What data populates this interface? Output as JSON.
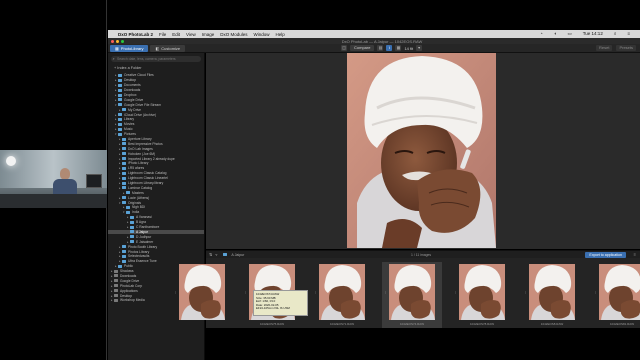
{
  "menubar": {
    "apple": "",
    "app_name": "DxO PhotoLab 2",
    "items": [
      "File",
      "Edit",
      "View",
      "Image",
      "DxO Modules",
      "Window",
      "Help"
    ],
    "clock": "Tue 14:12"
  },
  "window": {
    "title": "DxO PhotoLab — A Jaipur — 1042EOS.RAW"
  },
  "toolbar": {
    "tabs": [
      {
        "label": "PhotoLibrary"
      },
      {
        "label": "Customize"
      }
    ],
    "compare": "Compare",
    "zoom": "14 fit",
    "reset": "Reset",
    "presets": "Presets"
  },
  "sidebar": {
    "search_placeholder": "Search date, lens, camera, parameters",
    "add_folder": "Index a Folder",
    "tree": [
      {
        "label": "Creative Cloud Files",
        "depth": 1,
        "tri": "▸"
      },
      {
        "label": "Desktop",
        "depth": 1,
        "tri": "▸"
      },
      {
        "label": "Documents",
        "depth": 1,
        "tri": "▸"
      },
      {
        "label": "Downloads",
        "depth": 1,
        "tri": "▸"
      },
      {
        "label": "Dropbox",
        "depth": 1,
        "tri": "▸"
      },
      {
        "label": "Google Drive",
        "depth": 1,
        "tri": "▸"
      },
      {
        "label": "Google Drive File Stream",
        "depth": 1,
        "tri": "▾"
      },
      {
        "label": "My Drive",
        "depth": 2,
        "tri": "▸"
      },
      {
        "label": "iCloud Drive (Archive)",
        "depth": 1,
        "tri": "▸"
      },
      {
        "label": "Library",
        "depth": 1,
        "tri": "▸"
      },
      {
        "label": "Movies",
        "depth": 1,
        "tri": "▸"
      },
      {
        "label": "Music",
        "depth": 1,
        "tri": "▸"
      },
      {
        "label": "Pictures",
        "depth": 1,
        "tri": "▾"
      },
      {
        "label": "Aperture Library",
        "depth": 2,
        "tri": "▸"
      },
      {
        "label": "Best Impressive Photos",
        "depth": 2,
        "tri": "▸"
      },
      {
        "label": "DxO Lab Images",
        "depth": 2,
        "tri": "▸"
      },
      {
        "label": "Hoboken (Joe 6M)",
        "depth": 2,
        "tri": "▸"
      },
      {
        "label": "Imported Library 2 already dupe",
        "depth": 2,
        "tri": "▸"
      },
      {
        "label": "iPhoto Library",
        "depth": 2,
        "tri": "▸"
      },
      {
        "label": "LR5 afores",
        "depth": 2,
        "tri": "▸"
      },
      {
        "label": "Lightroom Classic Catalog",
        "depth": 2,
        "tri": "▸"
      },
      {
        "label": "Lightroom Classic Lineartel",
        "depth": 2,
        "tri": "▸"
      },
      {
        "label": "Lightroom Library.library",
        "depth": 2,
        "tri": "▸"
      },
      {
        "label": "Luminar Catalog",
        "depth": 2,
        "tri": "▸"
      },
      {
        "label": "Masters",
        "depth": 3,
        "tri": "▸"
      },
      {
        "label": "Lucie (Athens)",
        "depth": 2,
        "tri": "▸"
      },
      {
        "label": "Originals",
        "depth": 2,
        "tri": "▾"
      },
      {
        "label": "Nigh BDI",
        "depth": 3,
        "tri": "▸"
      },
      {
        "label": "India",
        "depth": 3,
        "tri": "▾"
      },
      {
        "label": "A Varanasi",
        "depth": 4,
        "tri": "▸"
      },
      {
        "label": "B Agra",
        "depth": 4,
        "tri": "▸"
      },
      {
        "label": "C Ranthambore",
        "depth": 4,
        "tri": "▸"
      },
      {
        "label": "A Jaipur",
        "depth": 4,
        "tri": "",
        "selected": true
      },
      {
        "label": "D Jodhpur",
        "depth": 4,
        "tri": "▸"
      },
      {
        "label": "E Jaisalmer",
        "depth": 4,
        "tri": "▸"
      },
      {
        "label": "Photo Booth Library",
        "depth": 2,
        "tri": "▸"
      },
      {
        "label": "Photos Library",
        "depth": 2,
        "tri": "▸"
      },
      {
        "label": "Selectedvaults",
        "depth": 2,
        "tri": "▸"
      },
      {
        "label": "Ultra Essence Tune",
        "depth": 2,
        "tri": "▸"
      },
      {
        "label": "Public",
        "depth": 1,
        "tri": "▸"
      },
      {
        "label": "Shadows",
        "depth": 0,
        "tri": "▸"
      },
      {
        "label": "Downloads",
        "depth": 0,
        "tri": "▸"
      },
      {
        "label": "Google Drive",
        "depth": 0,
        "tri": "▸"
      },
      {
        "label": "PhotoLab Corp",
        "depth": 0,
        "tri": "▸"
      },
      {
        "label": "Applications",
        "depth": 0,
        "tri": "▸"
      },
      {
        "label": "Desktop",
        "depth": 0,
        "tri": "▸"
      },
      {
        "label": "Workshop Media",
        "depth": 0,
        "tri": "▸"
      }
    ]
  },
  "browser": {
    "path": "A Jaipur",
    "count": "1 / 11 images",
    "export_label": "Export to application"
  },
  "filmstrip": [
    {
      "caption": "",
      "selected": false
    },
    {
      "caption": "1042EOS75.RAW",
      "selected": false
    },
    {
      "caption": "1042EOS71.RAW",
      "selected": false
    },
    {
      "caption": "1042EOS74.RAW",
      "selected": true
    },
    {
      "caption": "1042EOS78.RAW",
      "selected": false
    },
    {
      "caption": "1042EOS8.RAW",
      "selected": false
    },
    {
      "caption": "1042EOS81.RAW",
      "selected": false
    }
  ],
  "tooltip": {
    "lines": [
      "1042EOS74.RAW",
      "Size: 35.60 MB",
      "Exif: 1/60, f/4.0",
      "Date: 2020-02-05",
      "EF24-105mm f/4L IS USM"
    ]
  },
  "colors": {
    "accent": "#3a6fb0",
    "folder": "#5aa2d6",
    "traffic_red": "#ff5f57",
    "traffic_yellow": "#febc2e",
    "traffic_green": "#28c840"
  }
}
